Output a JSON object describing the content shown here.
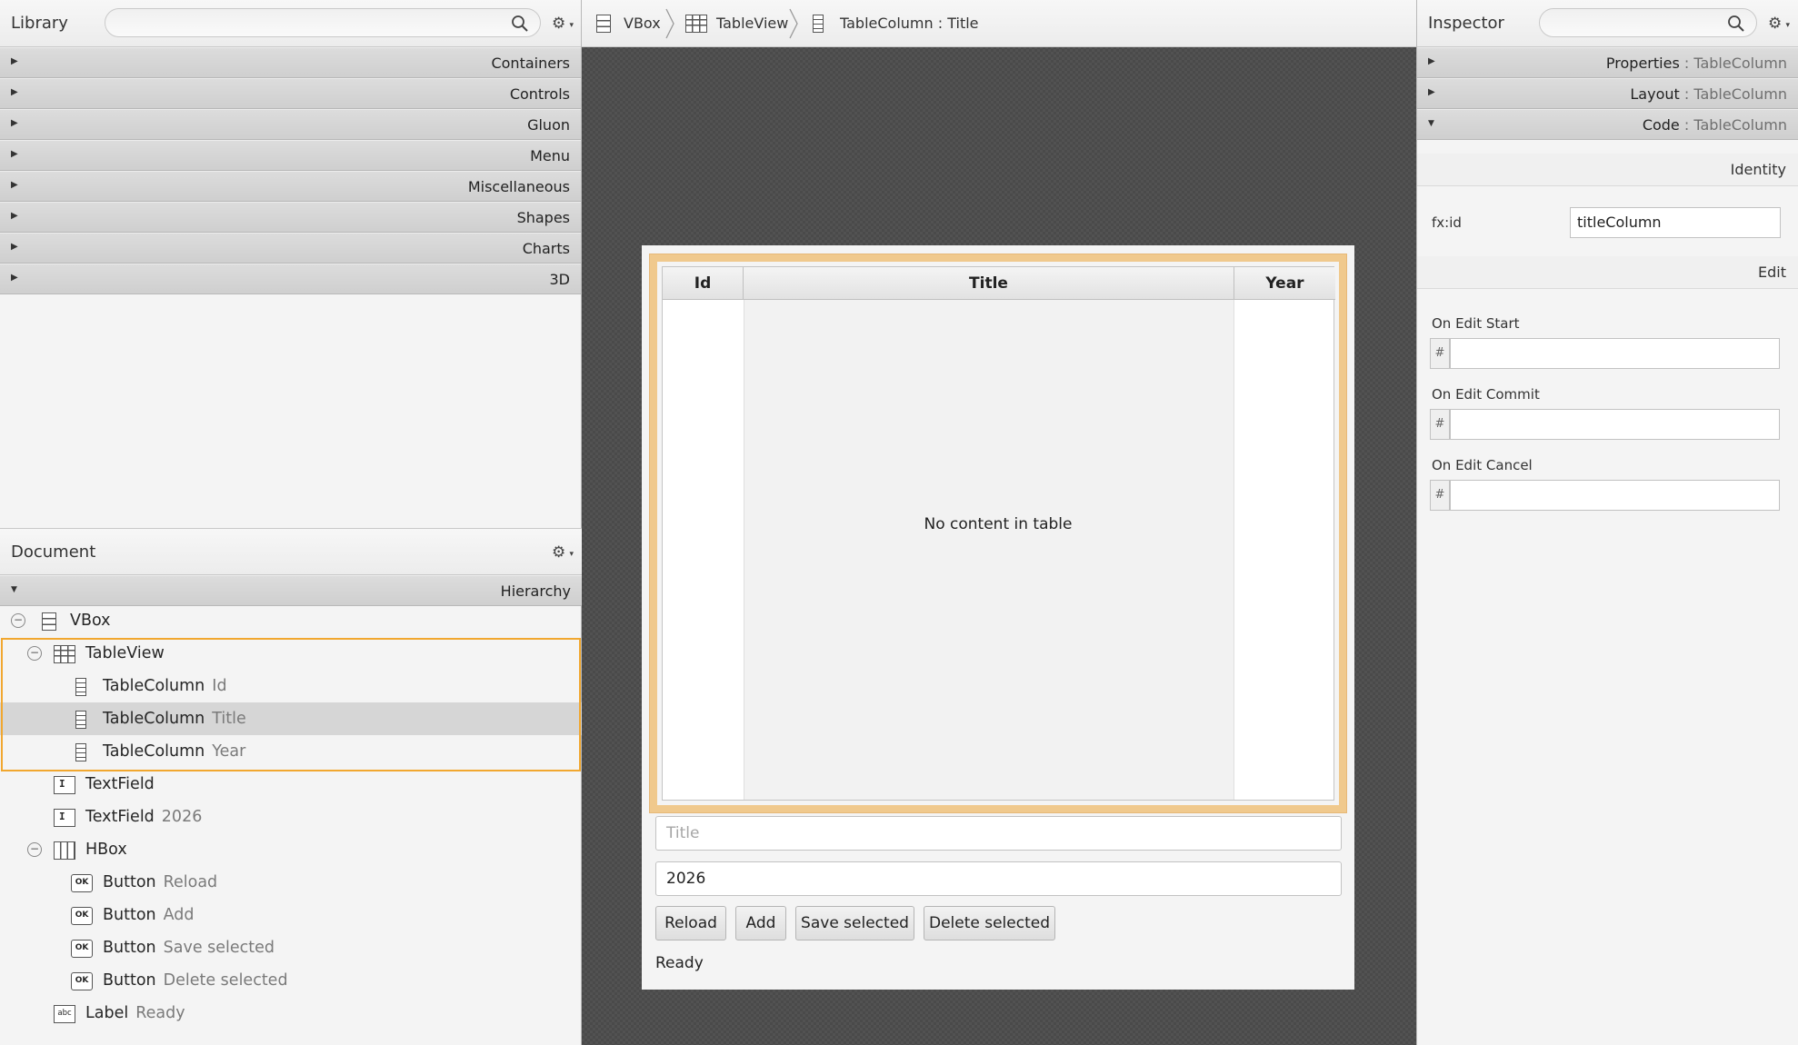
{
  "library": {
    "title": "Library",
    "categories": [
      "Containers",
      "Controls",
      "Gluon",
      "Menu",
      "Miscellaneous",
      "Shapes",
      "Charts",
      "3D"
    ]
  },
  "document": {
    "title": "Document",
    "hierarchy_label": "Hierarchy",
    "tree": [
      {
        "type": "VBox",
        "meta": ""
      },
      {
        "type": "TableView",
        "meta": ""
      },
      {
        "type": "TableColumn",
        "meta": "Id"
      },
      {
        "type": "TableColumn",
        "meta": "Title"
      },
      {
        "type": "TableColumn",
        "meta": "Year"
      },
      {
        "type": "TextField",
        "meta": ""
      },
      {
        "type": "TextField",
        "meta": "2026"
      },
      {
        "type": "HBox",
        "meta": ""
      },
      {
        "type": "Button",
        "meta": "Reload"
      },
      {
        "type": "Button",
        "meta": "Add"
      },
      {
        "type": "Button",
        "meta": "Save selected"
      },
      {
        "type": "Button",
        "meta": "Delete selected"
      },
      {
        "type": "Label",
        "meta": "Ready"
      }
    ],
    "icon_labels": {
      "textfield": "I",
      "button": "OK",
      "label": "abc"
    }
  },
  "breadcrumb": [
    "VBox",
    "TableView",
    "TableColumn : Title"
  ],
  "canvas": {
    "table": {
      "columns": [
        "Id",
        "Title",
        "Year"
      ],
      "placeholder": "No content in table"
    },
    "title_field_placeholder": "Title",
    "year_field_value": "2026",
    "buttons": [
      "Reload",
      "Add",
      "Save selected",
      "Delete selected"
    ],
    "status": "Ready"
  },
  "inspector": {
    "title": "Inspector",
    "sections": [
      {
        "name": "Properties",
        "target": "TableColumn"
      },
      {
        "name": "Layout",
        "target": "TableColumn"
      },
      {
        "name": "Code",
        "target": "TableColumn"
      }
    ],
    "separator": " : ",
    "identity_label": "Identity",
    "fxid_label": "fx:id",
    "fxid_value": "titleColumn",
    "edit_label": "Edit",
    "handler_prefix": "#",
    "handlers": [
      "On Edit Start",
      "On Edit Commit",
      "On Edit Cancel"
    ]
  },
  "colors": {
    "selection_border": "#f1a72f",
    "table_highlight": "#f0c98d",
    "inspector_accent": "#6f6f6f"
  }
}
